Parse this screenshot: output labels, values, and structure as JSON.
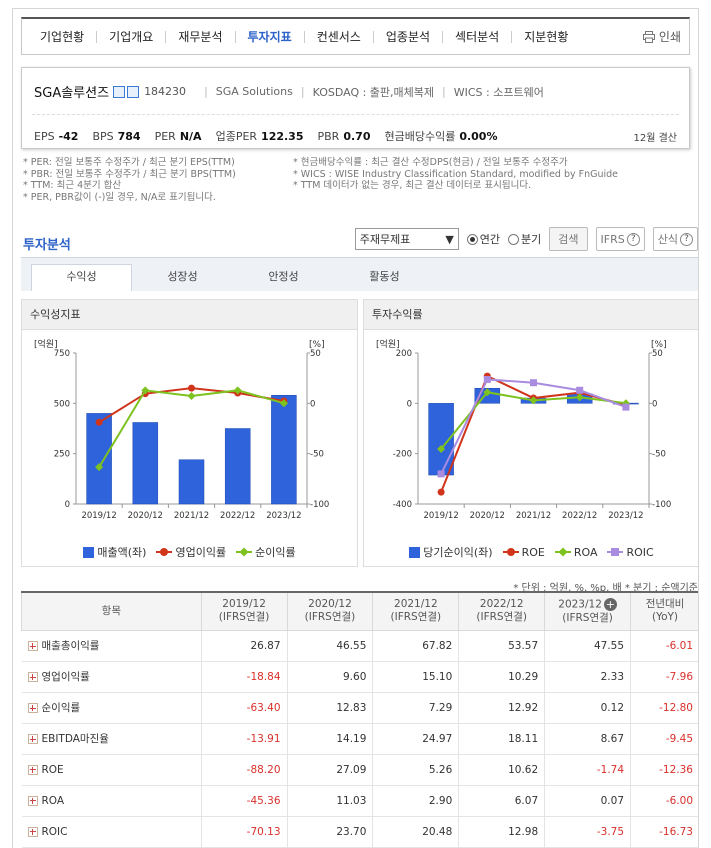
{
  "nav": {
    "items": [
      "기업현황",
      "기업개요",
      "재무분석",
      "투자지표",
      "컨센서스",
      "업종분석",
      "섹터분석",
      "지분현황"
    ],
    "active_index": 3,
    "print_label": "인쇄"
  },
  "company": {
    "name": "SGA솔루션즈",
    "code": "184230",
    "english_name": "SGA Solutions",
    "market": "KOSDAQ : 출판,매체복제",
    "wics": "WICS : 소프트웨어",
    "metrics": [
      {
        "label": "EPS",
        "value": "-42"
      },
      {
        "label": "BPS",
        "value": "784"
      },
      {
        "label": "PER",
        "value": "N/A"
      },
      {
        "label": "업종PER",
        "value": "122.35"
      },
      {
        "label": "PBR",
        "value": "0.70"
      },
      {
        "label": "현금배당수익률",
        "value": "0.00%"
      }
    ],
    "fiscal": "12월 결산"
  },
  "notes": {
    "left": [
      "* PER: 전일 보통주 수정주가 / 최근 분기 EPS(TTM)",
      "* PBR: 전일 보통주 수정주가 / 최근 분기 BPS(TTM)",
      "* TTM: 최근 4분기 합산",
      "* PER, PBR값이 (-)일 경우, N/A로 표기됩니다."
    ],
    "right": [
      "* 현금배당수익률 : 최근 결산 수정DPS(현금) / 전일 보통주 수정주가",
      "* WICS : WISE Industry Classification Standard, modified by FnGuide",
      "* TTM 데이터가 없는 경우, 최근 결산 데이터로 표시됩니다."
    ]
  },
  "section": {
    "title": "투자분석",
    "select_value": "주재무제표",
    "radio_annual": "연간",
    "radio_quarter": "분기",
    "search_button": "검색",
    "ifrs_button": "IFRS",
    "formula_button": "산식"
  },
  "tabs": [
    "수익성",
    "성장성",
    "안정성",
    "활동성"
  ],
  "charts": {
    "left_title": "수익성지표",
    "right_title": "투자수익률"
  },
  "chart_data": [
    {
      "type": "bar",
      "categories": [
        "2019/12",
        "2020/12",
        "2021/12",
        "2022/12",
        "2023/12"
      ],
      "y_left_unit": "[억원]",
      "y_right_unit": "[%]",
      "ylim_left": [
        0,
        750
      ],
      "ylim_right": [
        -100,
        50
      ],
      "y_left_ticks": [
        "750",
        "500",
        "250",
        "0"
      ],
      "y_right_ticks": [
        "50",
        "0",
        "-50",
        "-100"
      ],
      "series": [
        {
          "name": "매출액(좌)",
          "type": "bar",
          "axis": "left",
          "color": "#2f63db",
          "values": [
            450,
            405,
            220,
            375,
            540
          ]
        },
        {
          "name": "영업이익률",
          "type": "line",
          "axis": "right",
          "color": "#d0351b",
          "values": [
            -18.84,
            9.6,
            15.1,
            10.29,
            2.33
          ]
        },
        {
          "name": "순이익률",
          "type": "line",
          "axis": "right",
          "color": "#7dc21e",
          "values": [
            -63.4,
            12.83,
            7.29,
            12.92,
            0.12
          ]
        }
      ]
    },
    {
      "type": "bar",
      "categories": [
        "2019/12",
        "2020/12",
        "2021/12",
        "2022/12",
        "2023/12"
      ],
      "y_left_unit": "[억원]",
      "y_right_unit": "[%]",
      "ylim_left": [
        -400,
        200
      ],
      "ylim_right": [
        -100,
        50
      ],
      "y_left_ticks": [
        "200",
        "0",
        "-200",
        "-400"
      ],
      "y_right_ticks": [
        "50",
        "0",
        "-50",
        "-100"
      ],
      "series": [
        {
          "name": "당기순이익(좌)",
          "type": "bar",
          "axis": "left",
          "color": "#2f63db",
          "values": [
            -285,
            60,
            21,
            38,
            1
          ]
        },
        {
          "name": "ROE",
          "type": "line",
          "axis": "right",
          "color": "#d0351b",
          "values": [
            -88.2,
            27.09,
            5.26,
            10.62,
            -1.74
          ]
        },
        {
          "name": "ROA",
          "type": "line",
          "axis": "right",
          "color": "#7dc21e",
          "values": [
            -45.36,
            11.03,
            2.9,
            6.07,
            0.07
          ]
        },
        {
          "name": "ROIC",
          "type": "line",
          "axis": "right",
          "color": "#a98be0",
          "values": [
            -70.13,
            23.7,
            20.48,
            12.98,
            -3.75
          ]
        }
      ]
    }
  ],
  "units_note": "* 단위 : 억원, %, %p, 배    * 분기 : 순액기준",
  "table": {
    "headers": [
      {
        "main": "항목",
        "sub": ""
      },
      {
        "main": "2019/12",
        "sub": "(IFRS연결)"
      },
      {
        "main": "2020/12",
        "sub": "(IFRS연결)"
      },
      {
        "main": "2021/12",
        "sub": "(IFRS연결)"
      },
      {
        "main": "2022/12",
        "sub": "(IFRS연결)"
      },
      {
        "main": "2023/12",
        "sub": "(IFRS연결)"
      },
      {
        "main": "전년대비",
        "sub": "(YoY)"
      }
    ],
    "rows": [
      {
        "name": "매출총이익률",
        "values": [
          "26.87",
          "46.55",
          "67.82",
          "53.57",
          "47.55",
          "-6.01"
        ]
      },
      {
        "name": "영업이익률",
        "values": [
          "-18.84",
          "9.60",
          "15.10",
          "10.29",
          "2.33",
          "-7.96"
        ]
      },
      {
        "name": "순이익률",
        "values": [
          "-63.40",
          "12.83",
          "7.29",
          "12.92",
          "0.12",
          "-12.80"
        ]
      },
      {
        "name": "EBITDA마진율",
        "values": [
          "-13.91",
          "14.19",
          "24.97",
          "18.11",
          "8.67",
          "-9.45"
        ]
      },
      {
        "name": "ROE",
        "values": [
          "-88.20",
          "27.09",
          "5.26",
          "10.62",
          "-1.74",
          "-12.36"
        ]
      },
      {
        "name": "ROA",
        "values": [
          "-45.36",
          "11.03",
          "2.90",
          "6.07",
          "0.07",
          "-6.00"
        ]
      },
      {
        "name": "ROIC",
        "values": [
          "-70.13",
          "23.70",
          "20.48",
          "12.98",
          "-3.75",
          "-16.73"
        ]
      }
    ]
  }
}
